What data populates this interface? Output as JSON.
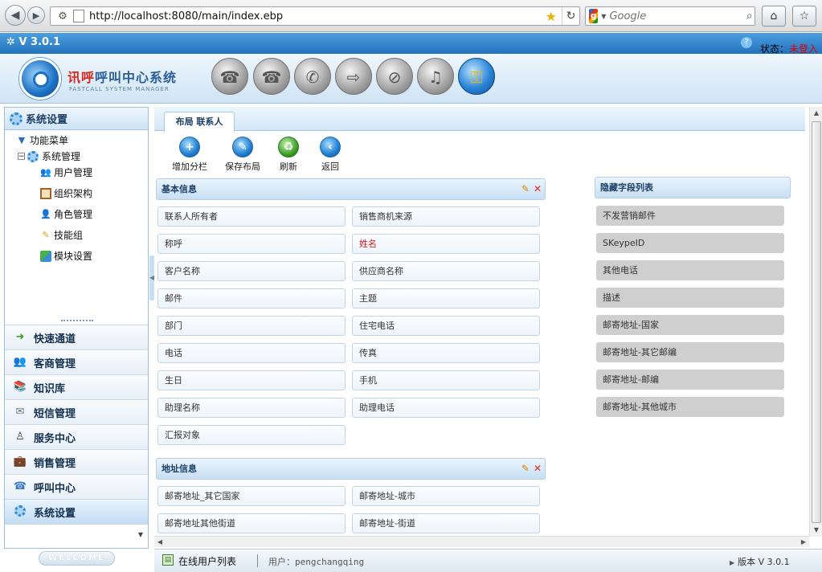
{
  "browser": {
    "url": "http://localhost:8080/main/index.ebp",
    "search_placeholder": "Google"
  },
  "app": {
    "version": "V 3.0.1",
    "status_label": "状态：",
    "status_value": "未登入"
  },
  "header": {
    "brand": "讯呼",
    "title": "呼叫中心系统",
    "subtitle": "FASTCALL SYSTEM MANAGER"
  },
  "left": {
    "title": "系统设置",
    "tree": {
      "root": "功能菜单",
      "group": "系统管理",
      "items": [
        "用户管理",
        "组织架构",
        "角色管理",
        "技能组",
        "模块设置"
      ]
    },
    "accordion": [
      "快速通道",
      "客商管理",
      "知识库",
      "短信管理",
      "服务中心",
      "销售管理",
      "呼叫中心",
      "系统设置"
    ],
    "welcome": "WELCOME"
  },
  "main": {
    "tab": "布局 联系人",
    "toolbar": [
      "增加分栏",
      "保存布局",
      "刷新",
      "返回"
    ],
    "basic_title": "基本信息",
    "basic_fields": [
      [
        "联系人所有者",
        "销售商机来源"
      ],
      [
        "称呼",
        "姓名"
      ],
      [
        "客户名称",
        "供应商名称"
      ],
      [
        "邮件",
        "主题"
      ],
      [
        "部门",
        "住宅电话"
      ],
      [
        "电话",
        "传真"
      ],
      [
        "生日",
        "手机"
      ],
      [
        "助理名称",
        "助理电话"
      ],
      [
        "汇报对象",
        ""
      ]
    ],
    "address_title": "地址信息",
    "address_fields": [
      [
        "邮寄地址_其它国家",
        "邮寄地址-城市"
      ],
      [
        "邮寄地址其他街道",
        "邮寄地址-街道"
      ]
    ],
    "hidden_title": "隐藏字段列表",
    "hidden_fields": [
      "不发营销邮件",
      "SKeypeID",
      "其他电话",
      "描述",
      "邮寄地址-国家",
      "邮寄地址-其它邮编",
      "邮寄地址-邮编",
      "邮寄地址-其他城市"
    ]
  },
  "statusbar": {
    "online_list": "在线用户列表",
    "user_label": "用户：",
    "user_name": "pengchangqing",
    "version": "版本 V 3.0.1"
  },
  "colors": {
    "accent": "#2273bd",
    "required": "#d11a1a",
    "status_error": "#e00000"
  }
}
